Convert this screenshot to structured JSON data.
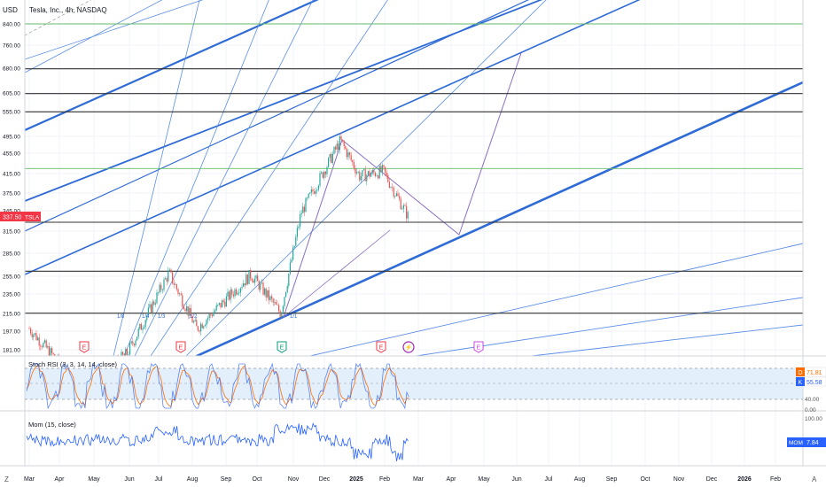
{
  "header": {
    "currency": "USD",
    "symbol_title": "Tesla, Inc., 4h, NASDAQ"
  },
  "price_badge": {
    "value": "337.50",
    "ticker": "TSLA",
    "color": "#f23645"
  },
  "price_axis": {
    "labels": [
      "840.00",
      "760.00",
      "680.00",
      "605.00",
      "555.00",
      "495.00",
      "455.00",
      "415.00",
      "375.00",
      "345.00",
      "315.00",
      "285.00",
      "255.00",
      "235.00",
      "215.00",
      "197.00",
      "181.00"
    ]
  },
  "time_axis": {
    "labels": [
      "Mar",
      "Apr",
      "May",
      "Jun",
      "Jul",
      "Aug",
      "Sep",
      "Oct",
      "Nov",
      "Dec",
      "2025",
      "Feb",
      "Mar",
      "Apr",
      "May",
      "Jun",
      "Jul",
      "Aug",
      "Sep",
      "Oct",
      "Nov",
      "Dec",
      "2026",
      "Feb"
    ],
    "bold_labels": [
      "2025",
      "2026"
    ],
    "left_icon": "Z",
    "right_icon": "A"
  },
  "fib_labels": [
    "1/8",
    "1/4",
    "1/3",
    "1/2",
    "1/1"
  ],
  "event_markers": [
    {
      "kind": "earnings",
      "letter": "E",
      "color": "#f23645"
    },
    {
      "kind": "earnings",
      "letter": "E",
      "color": "#f23645"
    },
    {
      "kind": "earnings",
      "letter": "E",
      "color": "#089981"
    },
    {
      "kind": "earnings",
      "letter": "E",
      "color": "#f23645"
    },
    {
      "kind": "dividend-flash",
      "letter": "⚡",
      "color": "#9c27b0"
    },
    {
      "kind": "earnings-future",
      "letter": "E",
      "color": "#cc48e0"
    }
  ],
  "stoch": {
    "label": "Stoch RSI (3, 3, 14, 14, close)",
    "axis_labels": [
      "40.00"
    ],
    "d_badge": {
      "letter": "D",
      "value": "71.81",
      "color": "#ff6d00"
    },
    "k_badge": {
      "letter": "K",
      "value": "55.58",
      "color": "#2962ff"
    }
  },
  "mom": {
    "label": "Mom (15, close)",
    "axis_labels": [
      "100.00",
      "0.00"
    ],
    "badge": {
      "name": "MOM",
      "value": "7.84",
      "color": "#2962ff"
    }
  },
  "colors": {
    "up_candle": "#26a69a",
    "down_candle": "#ef5350",
    "trendline_blue": "#2e6bd6",
    "thin_blue": "#5b8ee6",
    "horizontal_black": "#333333",
    "horizontal_green": "#66bb6a",
    "purple_line": "#8a6fc1",
    "stoch_band": "#e3f0fc"
  },
  "chart_data": [
    {
      "type": "candlestick",
      "title": "Tesla, Inc., 4h, NASDAQ",
      "ylabel": "USD",
      "ylim": [
        178,
        870
      ],
      "y_scale": "log",
      "x_range": [
        "2024-03",
        "2026-03"
      ],
      "last_price": 337.5,
      "approx_path": [
        {
          "date": "2024-03-01",
          "close": 200
        },
        {
          "date": "2024-04-20",
          "close": 150
        },
        {
          "date": "2024-06-01",
          "close": 178
        },
        {
          "date": "2024-07-10",
          "close": 260
        },
        {
          "date": "2024-08-05",
          "close": 200
        },
        {
          "date": "2024-09-25",
          "close": 258
        },
        {
          "date": "2024-10-23",
          "close": 215
        },
        {
          "date": "2024-11-11",
          "close": 345
        },
        {
          "date": "2024-12-18",
          "close": 485
        },
        {
          "date": "2025-01-05",
          "close": 410
        },
        {
          "date": "2025-01-27",
          "close": 420
        },
        {
          "date": "2025-02-20",
          "close": 337.5
        }
      ],
      "horizontal_levels": [
        {
          "price": 840,
          "color": "green"
        },
        {
          "price": 680,
          "color": "black"
        },
        {
          "price": 605,
          "color": "black"
        },
        {
          "price": 555,
          "color": "black"
        },
        {
          "price": 425,
          "color": "green"
        },
        {
          "price": 330,
          "color": "black"
        },
        {
          "price": 262,
          "color": "black"
        },
        {
          "price": 215,
          "color": "black"
        }
      ],
      "grid": true
    },
    {
      "type": "line",
      "title": "Stoch RSI (3, 3, 14, 14, close)",
      "ylim": [
        0,
        100
      ],
      "series": [
        {
          "name": "K",
          "last": 55.58
        },
        {
          "name": "D",
          "last": 71.81
        }
      ],
      "bands": [
        20,
        80
      ]
    },
    {
      "type": "line",
      "title": "Mom (15, close)",
      "series": [
        {
          "name": "MOM",
          "last": 7.84
        }
      ]
    }
  ]
}
